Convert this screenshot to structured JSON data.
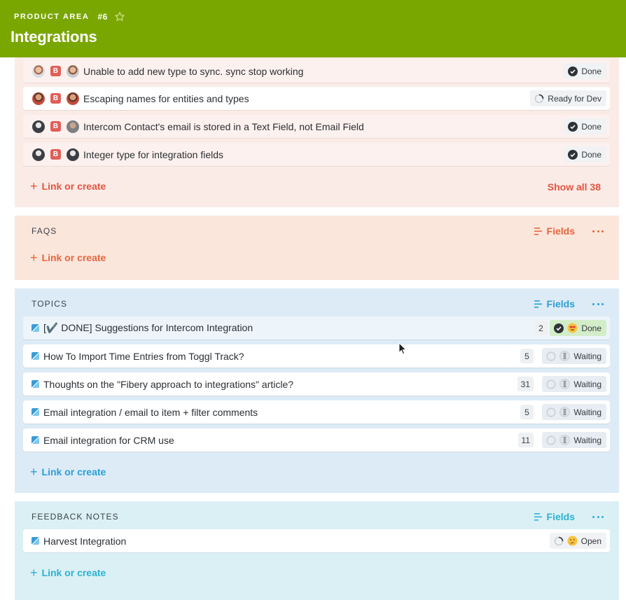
{
  "header": {
    "area_label": "PRODUCT AREA",
    "area_number": "#6",
    "title": "Integrations",
    "bg_color": "#7aa600"
  },
  "bugs": {
    "items": [
      {
        "title": "Unable to add new type to sync. sync stop working",
        "badge": "B",
        "status": "Done"
      },
      {
        "title": "Escaping names for entities and types",
        "badge": "B",
        "status": "Ready for Dev"
      },
      {
        "title": "Intercom Contact's email is stored in a Text Field, not Email Field",
        "badge": "B",
        "status": "Done"
      },
      {
        "title": "Integer type for integration fields",
        "badge": "B",
        "status": "Done"
      }
    ],
    "link_or_create": "Link or create",
    "show_all": "Show all 38",
    "accent": "#e2553f"
  },
  "faqs": {
    "title": "FAQS",
    "fields_label": "Fields",
    "link_or_create": "Link or create",
    "accent": "#e8653d"
  },
  "topics": {
    "title": "TOPICS",
    "fields_label": "Fields",
    "link_or_create": "Link or create",
    "accent": "#2a9fd6",
    "items": [
      {
        "title": "[✔️ DONE] Suggestions for Intercom Integration",
        "count": "2",
        "status": "Done"
      },
      {
        "title": "How To Import Time Entries from Toggl Track?",
        "count": "5",
        "status": "Waiting"
      },
      {
        "title": "Thoughts on the \"Fibery approach to integrations\" article?",
        "count": "31",
        "status": "Waiting"
      },
      {
        "title": "Email integration / email to item + filter comments",
        "count": "5",
        "status": "Waiting"
      },
      {
        "title": "Email integration for CRM use",
        "count": "11",
        "status": "Waiting"
      }
    ]
  },
  "feedback": {
    "title": "FEEDBACK NOTES",
    "fields_label": "Fields",
    "link_or_create": "Link or create",
    "accent": "#2bb2d0",
    "items": [
      {
        "title": "Harvest Integration",
        "status": "Open"
      }
    ]
  },
  "icons": {
    "star": "star-outline-icon",
    "fields": "lines-icon",
    "more": "ellipsis-icon",
    "done": "check-circle-icon",
    "in_progress": "spinner-icon",
    "waiting": "empty-circle-icon",
    "cursor": "mouse-pointer-icon"
  }
}
